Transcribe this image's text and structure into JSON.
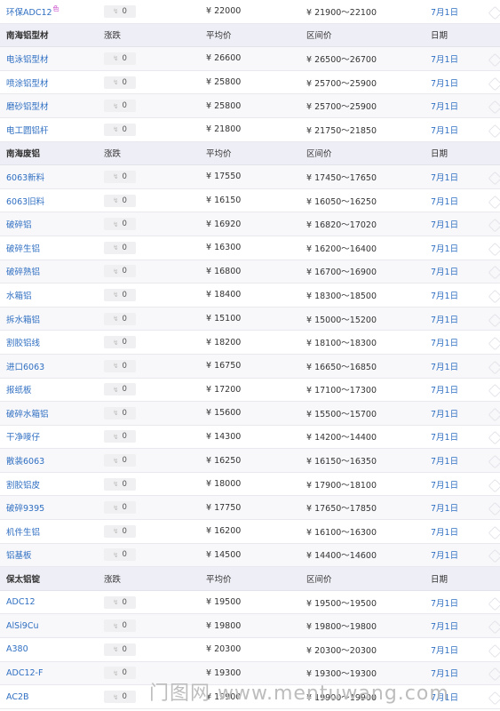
{
  "sections": [
    {
      "header": null,
      "rows": [
        {
          "name": "环保ADC12",
          "badge": "色",
          "change": "0",
          "avg": "¥ 22000",
          "range": "¥ 21900～22100",
          "date": "7月1日"
        }
      ]
    },
    {
      "header": {
        "name": "南海铝型材",
        "change": "涨跌",
        "avg": "平均价",
        "range": "区间价",
        "date": "日期"
      },
      "rows": [
        {
          "name": "电泳铝型材",
          "change": "0",
          "avg": "¥ 26600",
          "range": "¥ 26500～26700",
          "date": "7月1日"
        },
        {
          "name": "喷涂铝型材",
          "change": "0",
          "avg": "¥ 25800",
          "range": "¥ 25700～25900",
          "date": "7月1日"
        },
        {
          "name": "磨砂铝型材",
          "change": "0",
          "avg": "¥ 25800",
          "range": "¥ 25700～25900",
          "date": "7月1日"
        },
        {
          "name": "电工圆铝杆",
          "change": "0",
          "avg": "¥ 21800",
          "range": "¥ 21750～21850",
          "date": "7月1日"
        }
      ]
    },
    {
      "header": {
        "name": "南海废铝",
        "change": "涨跌",
        "avg": "平均价",
        "range": "区间价",
        "date": "日期"
      },
      "rows": [
        {
          "name": "6063新料",
          "change": "0",
          "avg": "¥ 17550",
          "range": "¥ 17450～17650",
          "date": "7月1日"
        },
        {
          "name": "6063旧料",
          "change": "0",
          "avg": "¥ 16150",
          "range": "¥ 16050～16250",
          "date": "7月1日"
        },
        {
          "name": "破碎铝",
          "change": "0",
          "avg": "¥ 16920",
          "range": "¥ 16820～17020",
          "date": "7月1日"
        },
        {
          "name": "破碎生铝",
          "change": "0",
          "avg": "¥ 16300",
          "range": "¥ 16200～16400",
          "date": "7月1日"
        },
        {
          "name": "破碎熟铝",
          "change": "0",
          "avg": "¥ 16800",
          "range": "¥ 16700～16900",
          "date": "7月1日"
        },
        {
          "name": "水箱铝",
          "change": "0",
          "avg": "¥ 18400",
          "range": "¥ 18300～18500",
          "date": "7月1日"
        },
        {
          "name": "拆水箱铝",
          "change": "0",
          "avg": "¥ 15100",
          "range": "¥ 15000～15200",
          "date": "7月1日"
        },
        {
          "name": "割胶铝线",
          "change": "0",
          "avg": "¥ 18200",
          "range": "¥ 18100～18300",
          "date": "7月1日"
        },
        {
          "name": "进口6063",
          "change": "0",
          "avg": "¥ 16750",
          "range": "¥ 16650～16850",
          "date": "7月1日"
        },
        {
          "name": "报纸板",
          "change": "0",
          "avg": "¥ 17200",
          "range": "¥ 17100～17300",
          "date": "7月1日"
        },
        {
          "name": "破碎水箱铝",
          "change": "0",
          "avg": "¥ 15600",
          "range": "¥ 15500～15700",
          "date": "7月1日"
        },
        {
          "name": "干净嘜仔",
          "change": "0",
          "avg": "¥ 14300",
          "range": "¥ 14200～14400",
          "date": "7月1日"
        },
        {
          "name": "散装6063",
          "change": "0",
          "avg": "¥ 16250",
          "range": "¥ 16150～16350",
          "date": "7月1日"
        },
        {
          "name": "割胶铝皮",
          "change": "0",
          "avg": "¥ 18000",
          "range": "¥ 17900～18100",
          "date": "7月1日"
        },
        {
          "name": "破碎9395",
          "change": "0",
          "avg": "¥ 17750",
          "range": "¥ 17650～17850",
          "date": "7月1日"
        },
        {
          "name": "机件生铝",
          "change": "0",
          "avg": "¥ 16200",
          "range": "¥ 16100～16300",
          "date": "7月1日"
        },
        {
          "name": "铝基板",
          "change": "0",
          "avg": "¥ 14500",
          "range": "¥ 14400～14600",
          "date": "7月1日"
        }
      ]
    },
    {
      "header": {
        "name": "保太铝锭",
        "change": "涨跌",
        "avg": "平均价",
        "range": "区间价",
        "date": "日期"
      },
      "rows": [
        {
          "name": "ADC12",
          "change": "0",
          "avg": "¥ 19500",
          "range": "¥ 19500～19500",
          "date": "7月1日"
        },
        {
          "name": "AlSi9Cu",
          "change": "0",
          "avg": "¥ 19800",
          "range": "¥ 19800～19800",
          "date": "7月1日"
        },
        {
          "name": "A380",
          "change": "0",
          "avg": "¥ 20300",
          "range": "¥ 20300～20300",
          "date": "7月1日"
        },
        {
          "name": "ADC12-F",
          "change": "0",
          "avg": "¥ 19300",
          "range": "¥ 19300～19300",
          "date": "7月1日"
        },
        {
          "name": "AC2B",
          "change": "0",
          "avg": "¥ 19900",
          "range": "¥ 19900～19900",
          "date": "7月1日"
        }
      ]
    }
  ],
  "watermark": "门图网 www.mentuwang.com",
  "icons": {
    "change_arrow": "trend-arrow-icon",
    "badge": "tag-badge-icon"
  },
  "colors": {
    "link": "#2f6fc2",
    "header_bg": "#eeeef6",
    "stripe": "#f8f8fa"
  }
}
